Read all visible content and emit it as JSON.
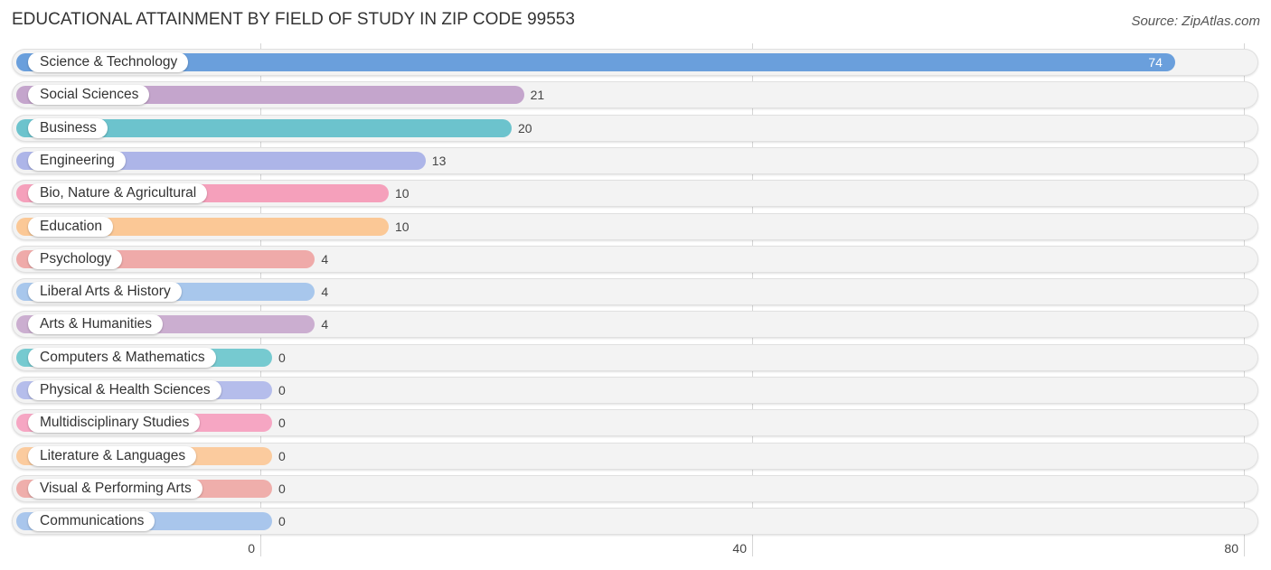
{
  "header": {
    "title": "EDUCATIONAL ATTAINMENT BY FIELD OF STUDY IN ZIP CODE 99553",
    "source": "Source: ZipAtlas.com"
  },
  "chart_data": {
    "type": "bar",
    "orientation": "horizontal",
    "title": "EDUCATIONAL ATTAINMENT BY FIELD OF STUDY IN ZIP CODE 99553",
    "xlabel": "",
    "ylabel": "",
    "xlim": [
      0,
      80
    ],
    "x_ticks": [
      0,
      40,
      80
    ],
    "x_tick_labels": [
      "0",
      "40",
      "80"
    ],
    "grid": true,
    "categories": [
      "Science & Technology",
      "Social Sciences",
      "Business",
      "Engineering",
      "Bio, Nature & Agricultural",
      "Education",
      "Psychology",
      "Liberal Arts & History",
      "Arts & Humanities",
      "Computers & Mathematics",
      "Physical & Health Sciences",
      "Multidisciplinary Studies",
      "Literature & Languages",
      "Visual & Performing Arts",
      "Communications"
    ],
    "values": [
      74,
      21,
      20,
      13,
      10,
      10,
      4,
      4,
      4,
      0,
      0,
      0,
      0,
      0,
      0
    ],
    "value_labels": [
      "74",
      "21",
      "20",
      "13",
      "10",
      "10",
      "4",
      "4",
      "4",
      "0",
      "0",
      "0",
      "0",
      "0",
      "0"
    ],
    "colors": [
      "#6a9fdc",
      "#c4a5cc",
      "#6cc3cd",
      "#adb5e8",
      "#f5a0bb",
      "#fbc896",
      "#efaaa9",
      "#a8c7ec",
      "#cbaed0",
      "#76cad0",
      "#b5bdeb",
      "#f6a6c3",
      "#fbcb9e",
      "#efaeab",
      "#a9c6ec"
    ]
  }
}
